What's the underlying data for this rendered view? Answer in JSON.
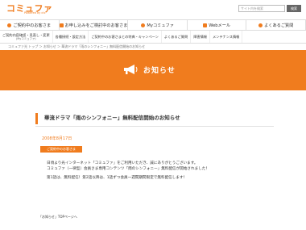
{
  "header": {
    "logo": "コミュファ",
    "logo_sub": "Powered by ctc",
    "search_placeholder": "サイト内を検索",
    "search_button": "検索"
  },
  "main_nav": [
    {
      "label": "ご契約中のお客さま",
      "icon": "home-icon"
    },
    {
      "label": "お申し込みをご検討中のお客さま",
      "icon": "document-icon"
    },
    {
      "label": "Myコミュファ",
      "icon": "person-icon"
    },
    {
      "label": "Webメール",
      "icon": "mail-icon"
    },
    {
      "label": "よくあるご質問",
      "icon": "question-icon"
    }
  ],
  "sub_nav": [
    {
      "label": "ご契約内容確認・見直し・変更",
      "sub": "(Myコミュファ)"
    },
    {
      "label": "各種接続・設定方法",
      "sub": ""
    },
    {
      "label": "ご契約中のお客さまとの特典・キャンペーン",
      "sub": ""
    },
    {
      "label": "よくあるご質問",
      "sub": ""
    },
    {
      "label": "障害情報",
      "sub": ""
    },
    {
      "label": "メンテナンス情報",
      "sub": ""
    }
  ],
  "breadcrumb": "コミュファ光 トップ ＞ お知らせ ＞ 華流ドラマ「雨のシンフォニー」無料配信開始のお知らせ",
  "banner": {
    "title": "お知らせ",
    "color": "#f07c1e"
  },
  "article": {
    "title": "華流ドラマ「雨のシンフォニー」無料配信開始のお知らせ",
    "date": "2008年8月17日",
    "badge": "ご契約中のお客さま",
    "paragraphs": [
      "日頃より光インターネット「コミュファ」をご利用いただき、誠にありがとうございます。",
      "コミュファ（一律型）会員さま専用コンテンツ「雨のシンフォニー」無料配信が開始されました！",
      "",
      "第1話は、無料配信！第2話以降は、1話ずつ会員一週間期間限定で無料配信します！"
    ]
  },
  "footer": {
    "link": "「お知らせ」TOPページへ"
  }
}
